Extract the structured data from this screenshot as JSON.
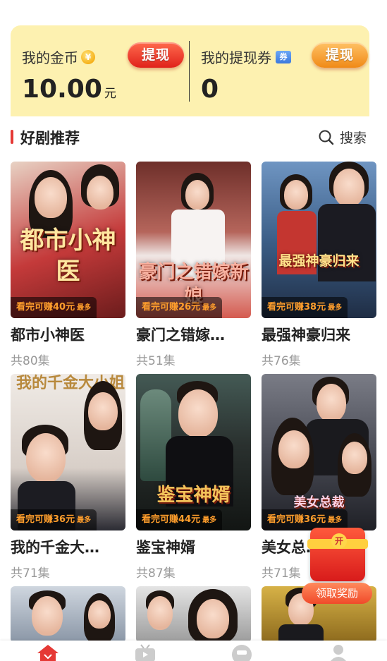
{
  "wallet": {
    "coins_label": "我的金币",
    "coins_amount": "10.00",
    "coins_unit": "元",
    "coins_withdraw": "提现",
    "tickets_label": "我的提现券",
    "tickets_amount": "0",
    "tickets_withdraw": "提现"
  },
  "section": {
    "title": "好剧推荐",
    "search_label": "搜索"
  },
  "dramas": [
    {
      "title": "都市小神医",
      "art": "都市小神医",
      "earn": "看完可赚40元",
      "max": "最多",
      "episodes": "共80集",
      "bg": "#b23b3b"
    },
    {
      "title": "豪门之错嫁…",
      "art": "豪门之错嫁新娘",
      "earn": "看完可赚26元",
      "max": "最多",
      "episodes": "共51集",
      "bg": "#a0504a"
    },
    {
      "title": "最强神豪归来",
      "art": "最强神豪归来",
      "earn": "看完可赚38元",
      "max": "最多",
      "episodes": "共76集",
      "bg": "#4a6c92"
    },
    {
      "title": "我的千金大…",
      "art": "我的千金大小姐",
      "earn": "看完可赚36元",
      "max": "最多",
      "episodes": "共71集",
      "bg": "#d9cfc7"
    },
    {
      "title": "鉴宝神婿",
      "art": "鉴宝神婿",
      "earn": "看完可赚44元",
      "max": "最多",
      "episodes": "共87集",
      "bg": "#2f3a36"
    },
    {
      "title": "美女总…",
      "art": "美女总裁",
      "earn": "看完可赚36元",
      "max": "最多",
      "episodes": "共71集",
      "bg": "#4d4f5a"
    }
  ],
  "reward": {
    "label": "领取奖励",
    "coin_text": "开"
  },
  "colors": {
    "wallet_bg": "#fdf1b0",
    "accent_red": "#e53935",
    "earn_orange": "#ff9e2c"
  },
  "icons": {
    "coin": "yuan-coin-icon",
    "ticket": "ticket-icon",
    "search": "search-icon",
    "nav": [
      "home-icon",
      "tv-icon",
      "task-icon",
      "profile-icon"
    ]
  }
}
